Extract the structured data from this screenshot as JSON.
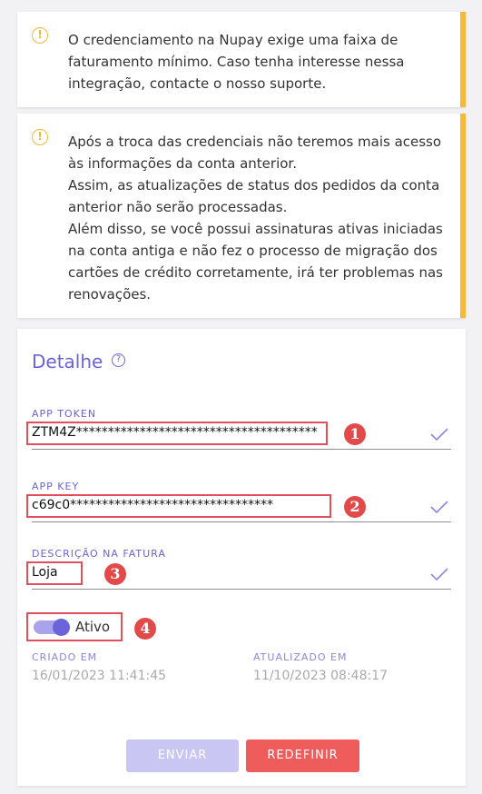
{
  "alerts": {
    "nupay": "O credenciamento na Nupay exige uma faixa de faturamento mínimo. Caso tenha interesse nessa integração, contacte o nosso suporte.",
    "credentials": [
      "Após a troca das credenciais não teremos mais acesso às informações da conta anterior.",
      "Assim, as atualizações de status dos pedidos da conta anterior não serão processadas.",
      "Além disso, se você possui assinaturas ativas iniciadas na conta antiga e não fez o processo de migração dos cartões de crédito corretamente, irá ter problemas nas renovações."
    ],
    "icon_text": "!"
  },
  "detail": {
    "title": "Detalhe",
    "help_icon_text": "?",
    "app_token": {
      "label": "APP TOKEN",
      "value": "ZTM4Z**************************************",
      "badge": "1"
    },
    "app_key": {
      "label": "APP KEY",
      "value": "c69c0********************************",
      "badge": "2"
    },
    "invoice_description": {
      "label": "DESCRIÇÃO NA FATURA",
      "value": "Loja",
      "badge": "3"
    },
    "active_toggle": {
      "label": "Ativo",
      "on": true,
      "badge": "4"
    },
    "created": {
      "label": "CRIADO EM",
      "value": "16/01/2023 11:41:45"
    },
    "updated": {
      "label": "ATUALIZADO EM",
      "value": "11/10/2023 08:48:17"
    },
    "buttons": {
      "send": "ENVIAR",
      "reset": "REDEFINIR"
    }
  },
  "colors": {
    "accent": "#6a64d8",
    "warning": "#f5b93a",
    "danger": "#ee5c5c",
    "highlight": "#e04f5a"
  }
}
